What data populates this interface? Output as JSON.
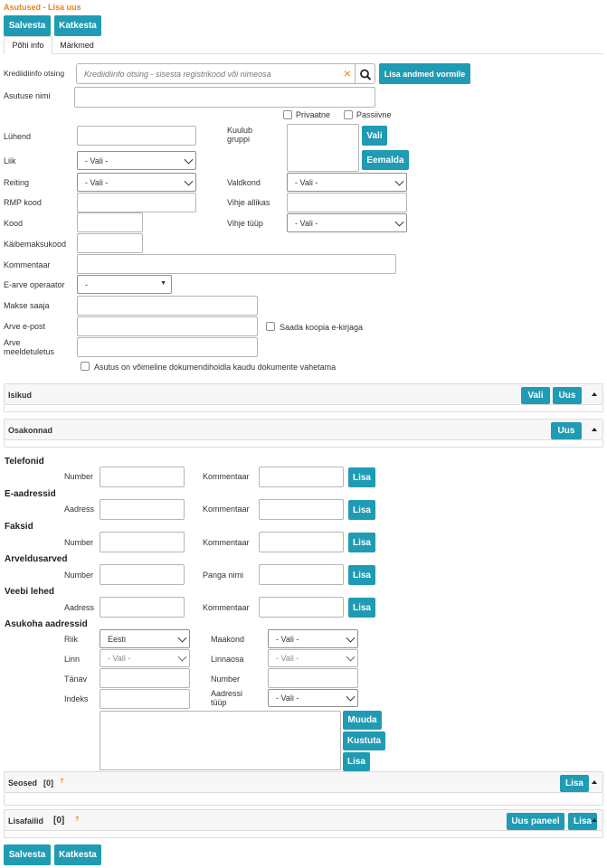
{
  "breadcrumb": "Asutused - Lisa uus",
  "top_actions": {
    "save": "Salvesta",
    "cancel": "Katkesta"
  },
  "tabs": [
    "Põhi info",
    "Märkmed"
  ],
  "credit_search": {
    "label": "Krediidiinfo otsing",
    "placeholder": "Krediidiinfo otsing - sisesta registrikood või nimeosa",
    "clear_icon": "×",
    "search_icon": "magnifier-icon",
    "add_button": "Lisa andmed vormile"
  },
  "form": {
    "asutuse_nimi": "Asutuse nimi",
    "privaatne": "Privaatne",
    "passiivne": "Passiivne",
    "luhend": "Lühend",
    "kuulub_gruppi": "Kuulub gruppi",
    "vali_btn": "Vali",
    "eemalda_btn": "Eemalda",
    "liik": "Liik",
    "liik_value": "- Vali -",
    "reiting": "Reiting",
    "reiting_value": "- Vali -",
    "valdkond": "Valdkond",
    "valdkond_value": "- Vali -",
    "rmp_kood": "RMP kood",
    "vihje_allikas": "Vihje allikas",
    "kood": "Kood",
    "vihje_tuup": "Vihje tüüp",
    "vihje_tuup_value": "- Vali -",
    "kaibemaksukood": "Käibemaksukood",
    "kommentaar": "Kommentaar",
    "earve_operaator": "E-arve operaator",
    "earve_operaator_value": "-",
    "makse_saaja": "Makse saaja",
    "arve_epost": "Arve e-post",
    "saada_koopia": "Saada koopia e-kirjaga",
    "arve_meeldetuletus": "Arve meeldetuletus",
    "dokumendihoidla": "Asutus on võimeline dokumendihoidla kaudu dokumente vahetama"
  },
  "panels": {
    "isikud": {
      "title": "Isikud",
      "vali": "Vali",
      "uus": "Uus"
    },
    "osakonnad": {
      "title": "Osakonnad",
      "uus": "Uus"
    },
    "seosed": {
      "title": "Seosed",
      "count": "[0]",
      "help": "?",
      "lisa": "Lisa"
    },
    "lisafailid": {
      "title": "Lisafailid",
      "count": "[0]",
      "help": "?",
      "uus_paneel": "Uus paneel",
      "lisa": "Lisa"
    }
  },
  "contacts": {
    "telefonid": {
      "title": "Telefonid",
      "f1": "Number",
      "f2": "Kommentaar",
      "btn": "Lisa"
    },
    "eaadressid": {
      "title": "E-aadressid",
      "f1": "Aadress",
      "f2": "Kommentaar",
      "btn": "Lisa"
    },
    "faksid": {
      "title": "Faksid",
      "f1": "Number",
      "f2": "Kommentaar",
      "btn": "Lisa"
    },
    "arveldusarved": {
      "title": "Arveldusarved",
      "f1": "Number",
      "f2": "Panga nimi",
      "btn": "Lisa"
    },
    "veebilehed": {
      "title": "Veebi lehed",
      "f1": "Aadress",
      "f2": "Kommentaar",
      "btn": "Lisa"
    }
  },
  "address": {
    "title": "Asukoha aadressid",
    "riik": "Riik",
    "riik_value": "Eesti",
    "maakond": "Maakond",
    "maakond_value": "- Vali -",
    "linn": "Linn",
    "linn_value": "- Vali -",
    "linnaosa": "Linnaosa",
    "linnaosa_value": "- Vali -",
    "tanav": "Tänav",
    "number": "Number",
    "indeks": "Indeks",
    "aadressi_tuup": "Aadressi tüüp",
    "aadressi_tuup_value": "- Vali -",
    "muuda": "Muuda",
    "kustuta": "Kustuta",
    "lisa": "Lisa"
  },
  "bottom_actions": {
    "save": "Salvesta",
    "cancel": "Katkesta"
  },
  "colors": {
    "accent": "#1f9bb4",
    "breadcrumb": "#f0801a"
  }
}
